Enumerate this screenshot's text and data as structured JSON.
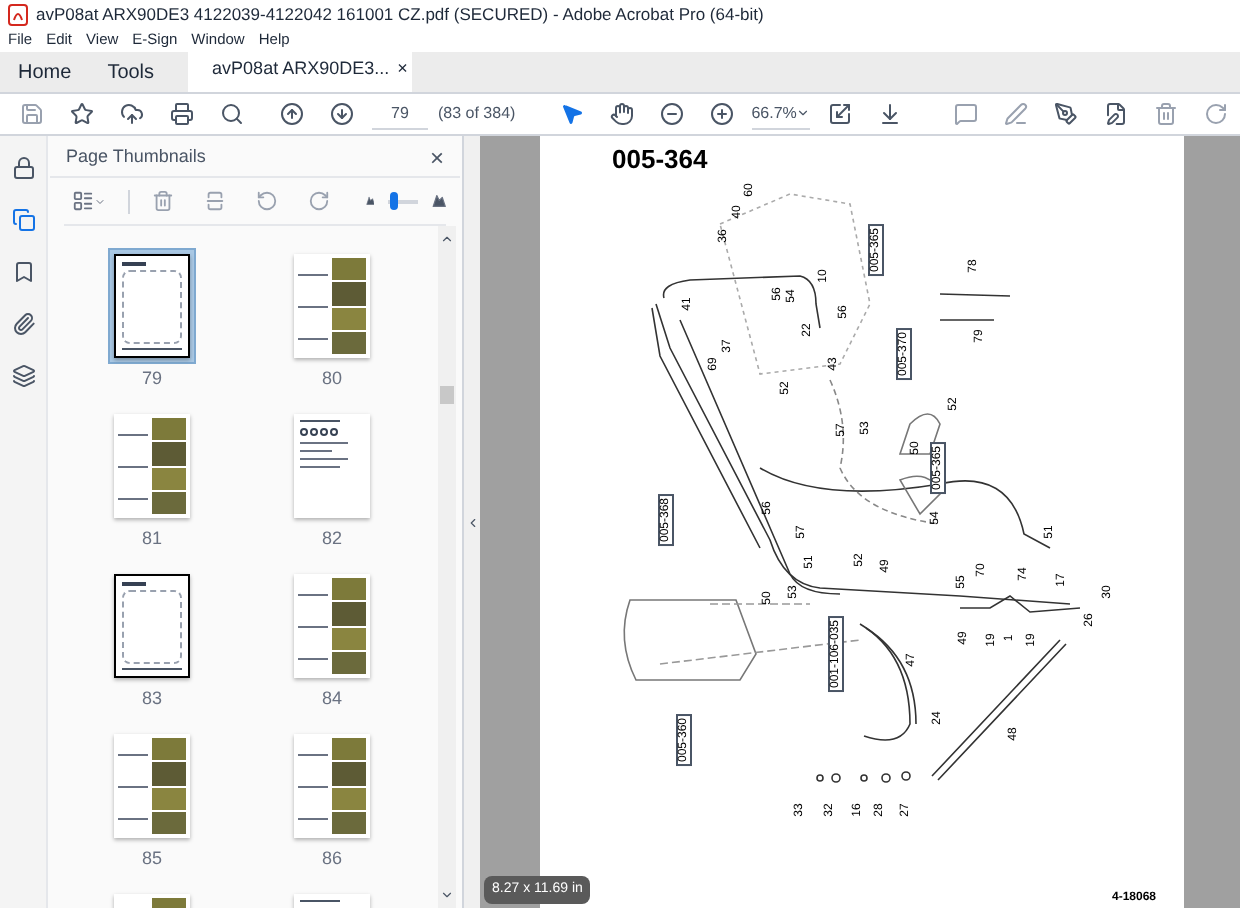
{
  "window": {
    "title": "avP08at ARX90DE3 4122039-4122042 161001 CZ.pdf (SECURED) - Adobe Acrobat Pro (64-bit)"
  },
  "menu": [
    "File",
    "Edit",
    "View",
    "E-Sign",
    "Window",
    "Help"
  ],
  "tabs": [
    {
      "label": "Home",
      "selected": false,
      "kind": "nav"
    },
    {
      "label": "Tools",
      "selected": false,
      "kind": "nav"
    },
    {
      "label": "avP08at ARX90DE3...",
      "selected": true,
      "kind": "document",
      "close": "×"
    }
  ],
  "toolbar": {
    "page_number": "79",
    "page_count": "(83 of 384)",
    "zoom": "66.7%"
  },
  "panel": {
    "title": "Page Thumbnails",
    "close": "×",
    "thumbnail_size": {
      "level": 0.05
    },
    "thumbnails": [
      {
        "label": "79",
        "kind": "drawing",
        "selected": true
      },
      {
        "label": "80",
        "kind": "photos",
        "selected": false
      },
      {
        "label": "81",
        "kind": "photos",
        "selected": false
      },
      {
        "label": "82",
        "kind": "text",
        "selected": false
      },
      {
        "label": "83",
        "kind": "drawing",
        "selected": false
      },
      {
        "label": "84",
        "kind": "photos",
        "selected": false
      },
      {
        "label": "85",
        "kind": "photos",
        "selected": false
      },
      {
        "label": "86",
        "kind": "photos",
        "selected": false
      },
      {
        "kind": "photos",
        "selected": false
      },
      {
        "kind": "text",
        "selected": false
      }
    ]
  },
  "document": {
    "heading": "005-364",
    "drawing_number": "4-18068",
    "page_size": "8.27 x 11.69 in",
    "callouts": [
      {
        "text": "60",
        "kind": "number"
      },
      {
        "text": "40",
        "kind": "number"
      },
      {
        "text": "36",
        "kind": "number"
      },
      {
        "text": "005-365",
        "kind": "reference"
      },
      {
        "text": "78",
        "kind": "number"
      },
      {
        "text": "10",
        "kind": "number"
      },
      {
        "text": "56",
        "kind": "number"
      },
      {
        "text": "54",
        "kind": "number"
      },
      {
        "text": "41",
        "kind": "number"
      },
      {
        "text": "56",
        "kind": "number"
      },
      {
        "text": "22",
        "kind": "number"
      },
      {
        "text": "37",
        "kind": "number"
      },
      {
        "text": "79",
        "kind": "number"
      },
      {
        "text": "69",
        "kind": "number"
      },
      {
        "text": "43",
        "kind": "number"
      },
      {
        "text": "005-370",
        "kind": "reference"
      },
      {
        "text": "52",
        "kind": "number"
      },
      {
        "text": "52",
        "kind": "number"
      },
      {
        "text": "57",
        "kind": "number"
      },
      {
        "text": "53",
        "kind": "number"
      },
      {
        "text": "50",
        "kind": "number"
      },
      {
        "text": "005-365",
        "kind": "reference"
      },
      {
        "text": "005-368",
        "kind": "reference"
      },
      {
        "text": "56",
        "kind": "number"
      },
      {
        "text": "54",
        "kind": "number"
      },
      {
        "text": "57",
        "kind": "number"
      },
      {
        "text": "51",
        "kind": "number"
      },
      {
        "text": "51",
        "kind": "number"
      },
      {
        "text": "52",
        "kind": "number"
      },
      {
        "text": "49",
        "kind": "number"
      },
      {
        "text": "70",
        "kind": "number"
      },
      {
        "text": "74",
        "kind": "number"
      },
      {
        "text": "55",
        "kind": "number"
      },
      {
        "text": "17",
        "kind": "number"
      },
      {
        "text": "53",
        "kind": "number"
      },
      {
        "text": "30",
        "kind": "number"
      },
      {
        "text": "50",
        "kind": "number"
      },
      {
        "text": "26",
        "kind": "number"
      },
      {
        "text": "49",
        "kind": "number"
      },
      {
        "text": "19",
        "kind": "number"
      },
      {
        "text": "1",
        "kind": "number"
      },
      {
        "text": "19",
        "kind": "number"
      },
      {
        "text": "001-106-035",
        "kind": "reference"
      },
      {
        "text": "47",
        "kind": "number"
      },
      {
        "text": "24",
        "kind": "number"
      },
      {
        "text": "48",
        "kind": "number"
      },
      {
        "text": "005-360",
        "kind": "reference"
      },
      {
        "text": "33",
        "kind": "number"
      },
      {
        "text": "32",
        "kind": "number"
      },
      {
        "text": "16",
        "kind": "number"
      },
      {
        "text": "28",
        "kind": "number"
      },
      {
        "text": "27",
        "kind": "number"
      }
    ]
  }
}
